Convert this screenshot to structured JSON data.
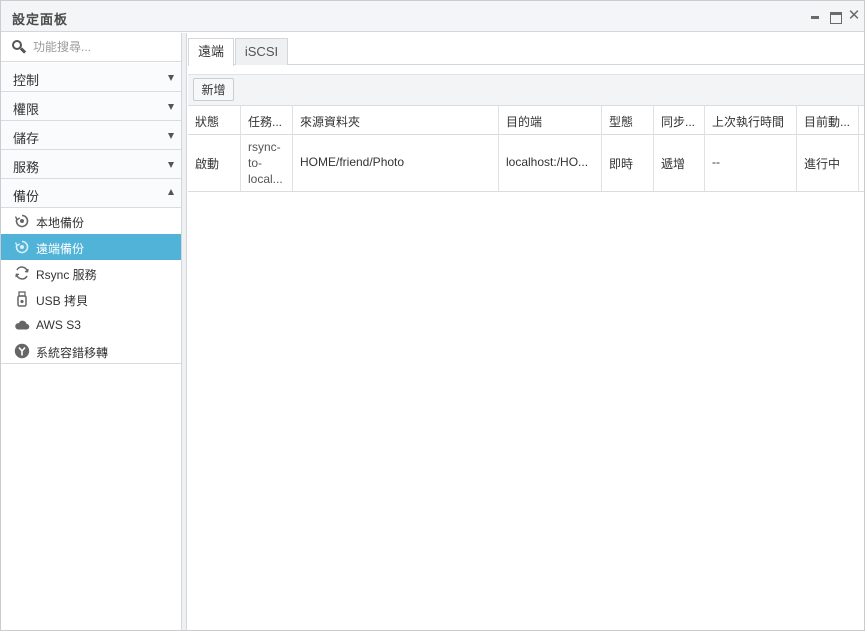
{
  "window": {
    "title": "設定面板",
    "minimize": "minimize",
    "maximize": "maximize",
    "close": "✕"
  },
  "search": {
    "placeholder": "功能搜尋..."
  },
  "sidebar": {
    "sections": [
      {
        "label": "控制",
        "expanded": false
      },
      {
        "label": "權限",
        "expanded": false
      },
      {
        "label": "儲存",
        "expanded": false
      },
      {
        "label": "服務",
        "expanded": false
      },
      {
        "label": "備份",
        "expanded": true
      }
    ],
    "items": [
      {
        "label": "本地備份",
        "icon": "local-backup-icon",
        "active": false
      },
      {
        "label": "遠端備份",
        "icon": "remote-backup-icon",
        "active": true
      },
      {
        "label": "Rsync 服務",
        "icon": "rsync-icon",
        "active": false
      },
      {
        "label": "USB 拷貝",
        "icon": "usb-icon",
        "active": false
      },
      {
        "label": "AWS S3",
        "icon": "cloud-icon",
        "active": false
      },
      {
        "label": "系統容錯移轉",
        "icon": "failover-icon",
        "active": false
      }
    ]
  },
  "tabs": [
    {
      "label": "遠端",
      "active": true
    },
    {
      "label": "iSCSI",
      "active": false
    }
  ],
  "toolbar": {
    "add_label": "新增"
  },
  "table": {
    "columns": [
      "狀態",
      "任務...",
      "來源資料夾",
      "目的端",
      "型態",
      "同步...",
      "上次執行時間",
      "目前動..."
    ],
    "rows": [
      {
        "status": "啟動",
        "task_lines": [
          "rsync-",
          "to-",
          "local..."
        ],
        "source": "HOME/friend/Photo",
        "destination": "localhost:/HO...",
        "type": "即時",
        "sync": "遞增",
        "last_run": "--",
        "current": "進行中"
      }
    ]
  },
  "colors": {
    "active_nav": "#52b3d9",
    "titlebar": "#f3f5f7"
  }
}
